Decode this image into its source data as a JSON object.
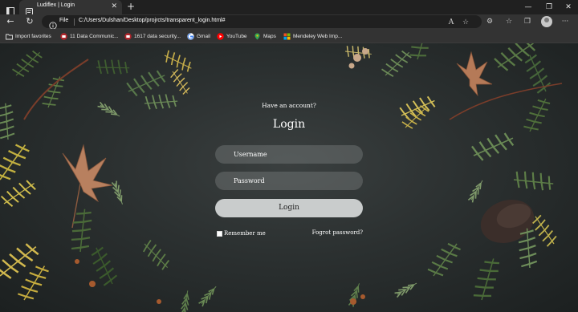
{
  "browser": {
    "tab": {
      "title": "Ludiflex | Login",
      "close_glyph": "✕"
    },
    "new_tab_glyph": "+",
    "window_controls": {
      "minimize": "—",
      "maximize": "❐",
      "close": "✕"
    },
    "address": {
      "scheme_label": "File",
      "url": "C:/Users/Dulshan/Desktop/projrcts/transparent_login.html#"
    },
    "nav": {
      "back": "←",
      "refresh": "↻"
    },
    "toolbar_icons": [
      "read-aloud-icon",
      "add-favorite-icon",
      "extensions-icon",
      "favorites-icon",
      "collections-icon",
      "profile-icon",
      "more-icon"
    ],
    "toolbar_glyphs": {
      "read_aloud": "A",
      "add_favorite": "☆",
      "extensions": "⚙",
      "favorites": "☆",
      "collections": "❐",
      "more": "···"
    }
  },
  "bookmarks": [
    {
      "label": "Import favorites",
      "icon": "folder-icon"
    },
    {
      "label": "11 Data Communic...",
      "icon": "site-icon"
    },
    {
      "label": "1617 data security...",
      "icon": "site-icon"
    },
    {
      "label": "Gmail",
      "icon": "google-icon"
    },
    {
      "label": "YouTube",
      "icon": "youtube-icon"
    },
    {
      "label": "Maps",
      "icon": "maps-icon"
    },
    {
      "label": "Mendeley Web Imp...",
      "icon": "microsoft-icon"
    }
  ],
  "login": {
    "prompt": "Have an account?",
    "title": "Login",
    "username_placeholder": "Username",
    "password_placeholder": "Password",
    "button_label": "Login",
    "remember_label": "Remember me",
    "forgot_label": "Fogrot password?"
  },
  "colors": {
    "browser_dark": "#202020",
    "toolbar": "#333333",
    "page_bg": "#2b3030",
    "input_bg": "rgba(120,125,125,0.45)",
    "button_bg": "#c9cccc",
    "text_light": "#ffffff"
  }
}
